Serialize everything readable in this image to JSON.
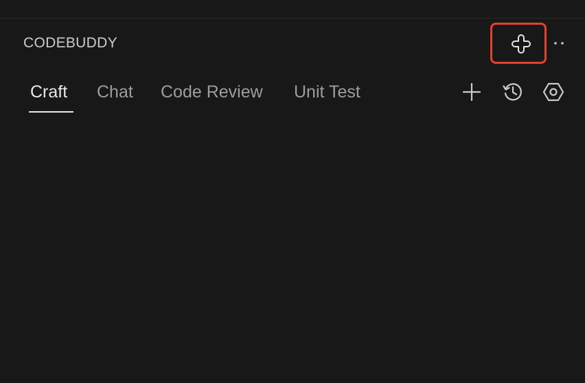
{
  "panel": {
    "title": "CODEBUDDY"
  },
  "header_actions": {
    "agent_icon": "puzzle-clover-icon",
    "more_icon": "more-horizontal-icon"
  },
  "tabs": [
    {
      "label": "Craft",
      "active": true
    },
    {
      "label": "Chat",
      "active": false
    },
    {
      "label": "Code Review",
      "active": false
    },
    {
      "label": "Unit Test",
      "active": false
    }
  ],
  "toolbar": {
    "new_icon": "plus-icon",
    "history_icon": "history-icon",
    "settings_icon": "hexagon-settings-icon"
  },
  "colors": {
    "background": "#181818",
    "highlight": "#e6402f",
    "text_active": "#e7e7e7",
    "text_inactive": "#9d9d9d"
  }
}
